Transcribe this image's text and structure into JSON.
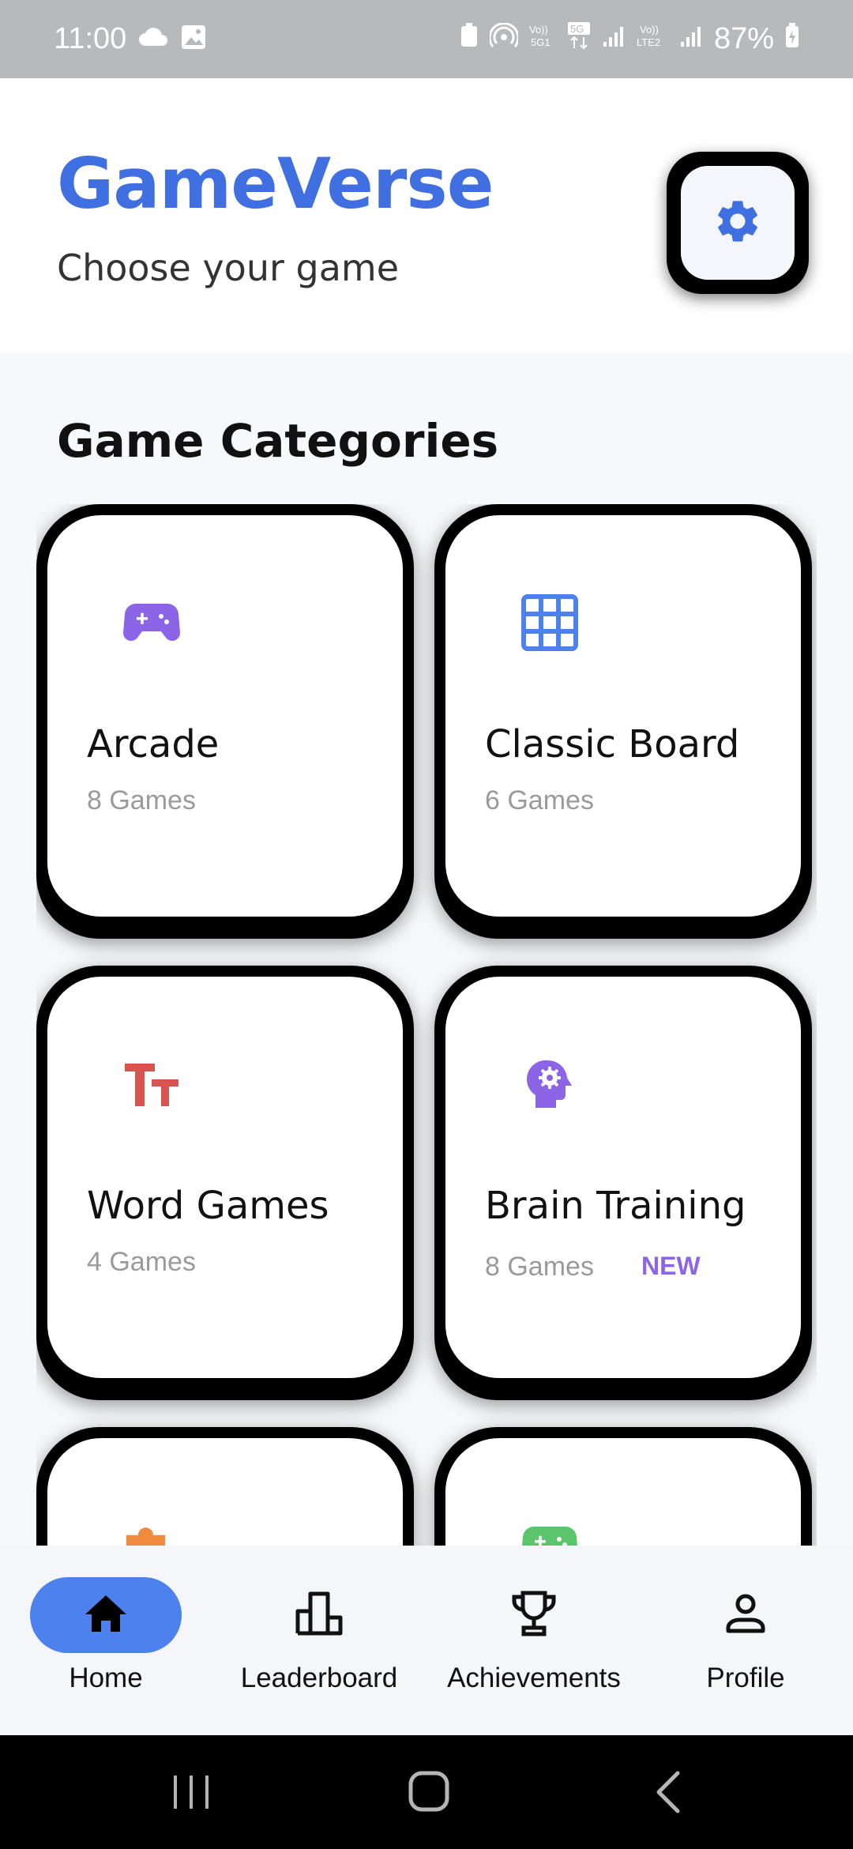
{
  "status_bar": {
    "time": "11:00",
    "battery": "87%",
    "left_icons": [
      "cloud-sync-icon",
      "image-icon"
    ],
    "right_icons": [
      "battery-saver-icon",
      "hotspot-icon",
      "volte-5g-icon",
      "5g-data-icon",
      "signal-icon",
      "volte-lte2-icon",
      "signal-icon",
      "charging-icon"
    ]
  },
  "header": {
    "title": "GameVerse",
    "subtitle": "Choose your game",
    "settings_icon": "gear-icon"
  },
  "categories": {
    "title": "Game Categories",
    "items": [
      {
        "name": "Arcade",
        "count": "8 Games",
        "icon": "gamepad-icon",
        "color": "#8b65e6"
      },
      {
        "name": "Classic Board",
        "count": "6 Games",
        "icon": "grid-icon",
        "color": "#4d82ee"
      },
      {
        "name": "Word Games",
        "count": "4 Games",
        "icon": "text-icon",
        "color": "#d9534f"
      },
      {
        "name": "Brain Training",
        "count": "8 Games",
        "badge": "NEW",
        "icon": "brain-gear-icon",
        "color": "#8b65e6"
      },
      {
        "icon": "puzzle-icon",
        "color": "#f08a3c"
      },
      {
        "icon": "gamepad-icon",
        "color": "#5cc46a"
      }
    ]
  },
  "bottom_nav": {
    "items": [
      {
        "label": "Home",
        "icon": "home-icon",
        "active": true
      },
      {
        "label": "Leaderboard",
        "icon": "leaderboard-icon",
        "active": false
      },
      {
        "label": "Achievements",
        "icon": "trophy-icon",
        "active": false
      },
      {
        "label": "Profile",
        "icon": "person-icon",
        "active": false
      }
    ]
  },
  "colors": {
    "accent": "#3f6fe0",
    "nav_active": "#4d82ee",
    "badge": "#8b65e6"
  }
}
